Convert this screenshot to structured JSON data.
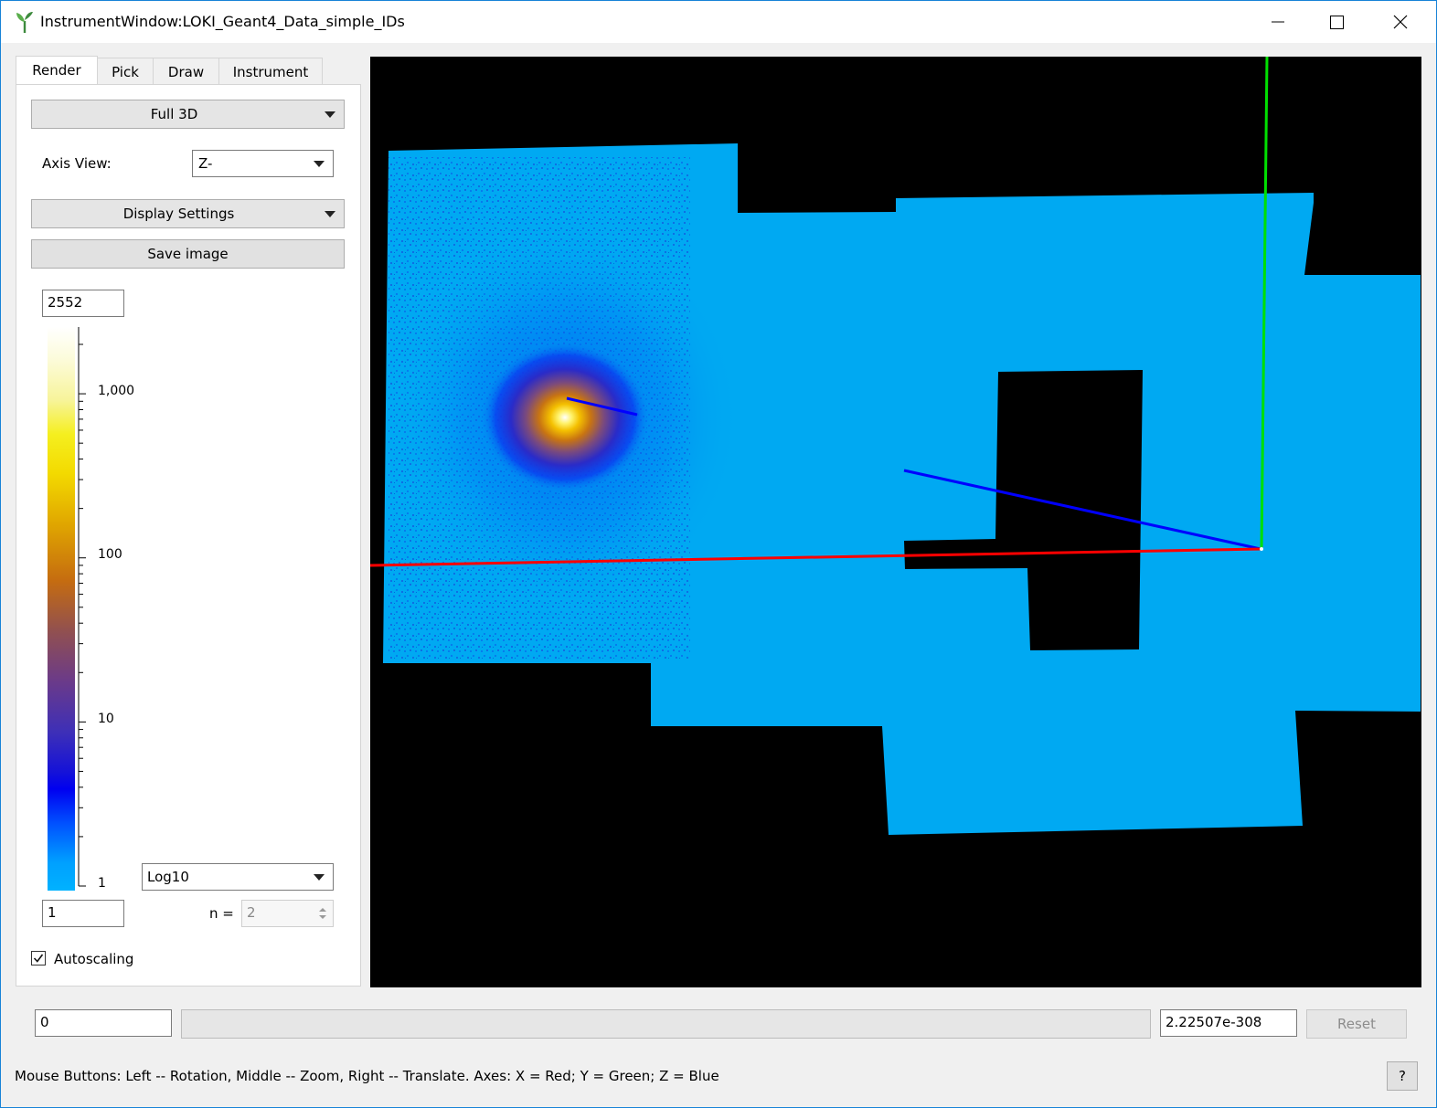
{
  "window": {
    "title": "InstrumentWindow:LOKI_Geant4_Data_simple_IDs"
  },
  "tabs": [
    {
      "label": "Render",
      "active": true
    },
    {
      "label": "Pick",
      "active": false
    },
    {
      "label": "Draw",
      "active": false
    },
    {
      "label": "Instrument",
      "active": false
    }
  ],
  "render": {
    "projection": "Full 3D",
    "axis_view_label": "Axis View:",
    "axis_view_value": "Z-",
    "display_settings_label": "Display Settings",
    "save_image_label": "Save image",
    "color_max": "2552",
    "color_min": "1",
    "scale_type": "Log10",
    "n_label": "n =",
    "n_value": "2",
    "autoscaling_label": "Autoscaling",
    "autoscaling_checked": true
  },
  "colorbar": {
    "scale": "log",
    "range": [
      1,
      2552
    ],
    "tick_labels": [
      "1,000",
      "100",
      "10",
      "1"
    ]
  },
  "bottom": {
    "min_value": "0",
    "max_value": "2.22507e-308",
    "reset_label": "Reset",
    "help_label": "?",
    "status": "Mouse Buttons: Left -- Rotation, Middle -- Zoom, Right -- Translate. Axes: X = Red; Y = Green; Z = Blue"
  },
  "colors": {
    "window_border": "#1883d7",
    "detector_fill": "#00a9f2",
    "viewport_bg": "#000000",
    "axis_x": "#ff0000",
    "axis_y": "#00e000",
    "axis_z": "#0000ff"
  }
}
